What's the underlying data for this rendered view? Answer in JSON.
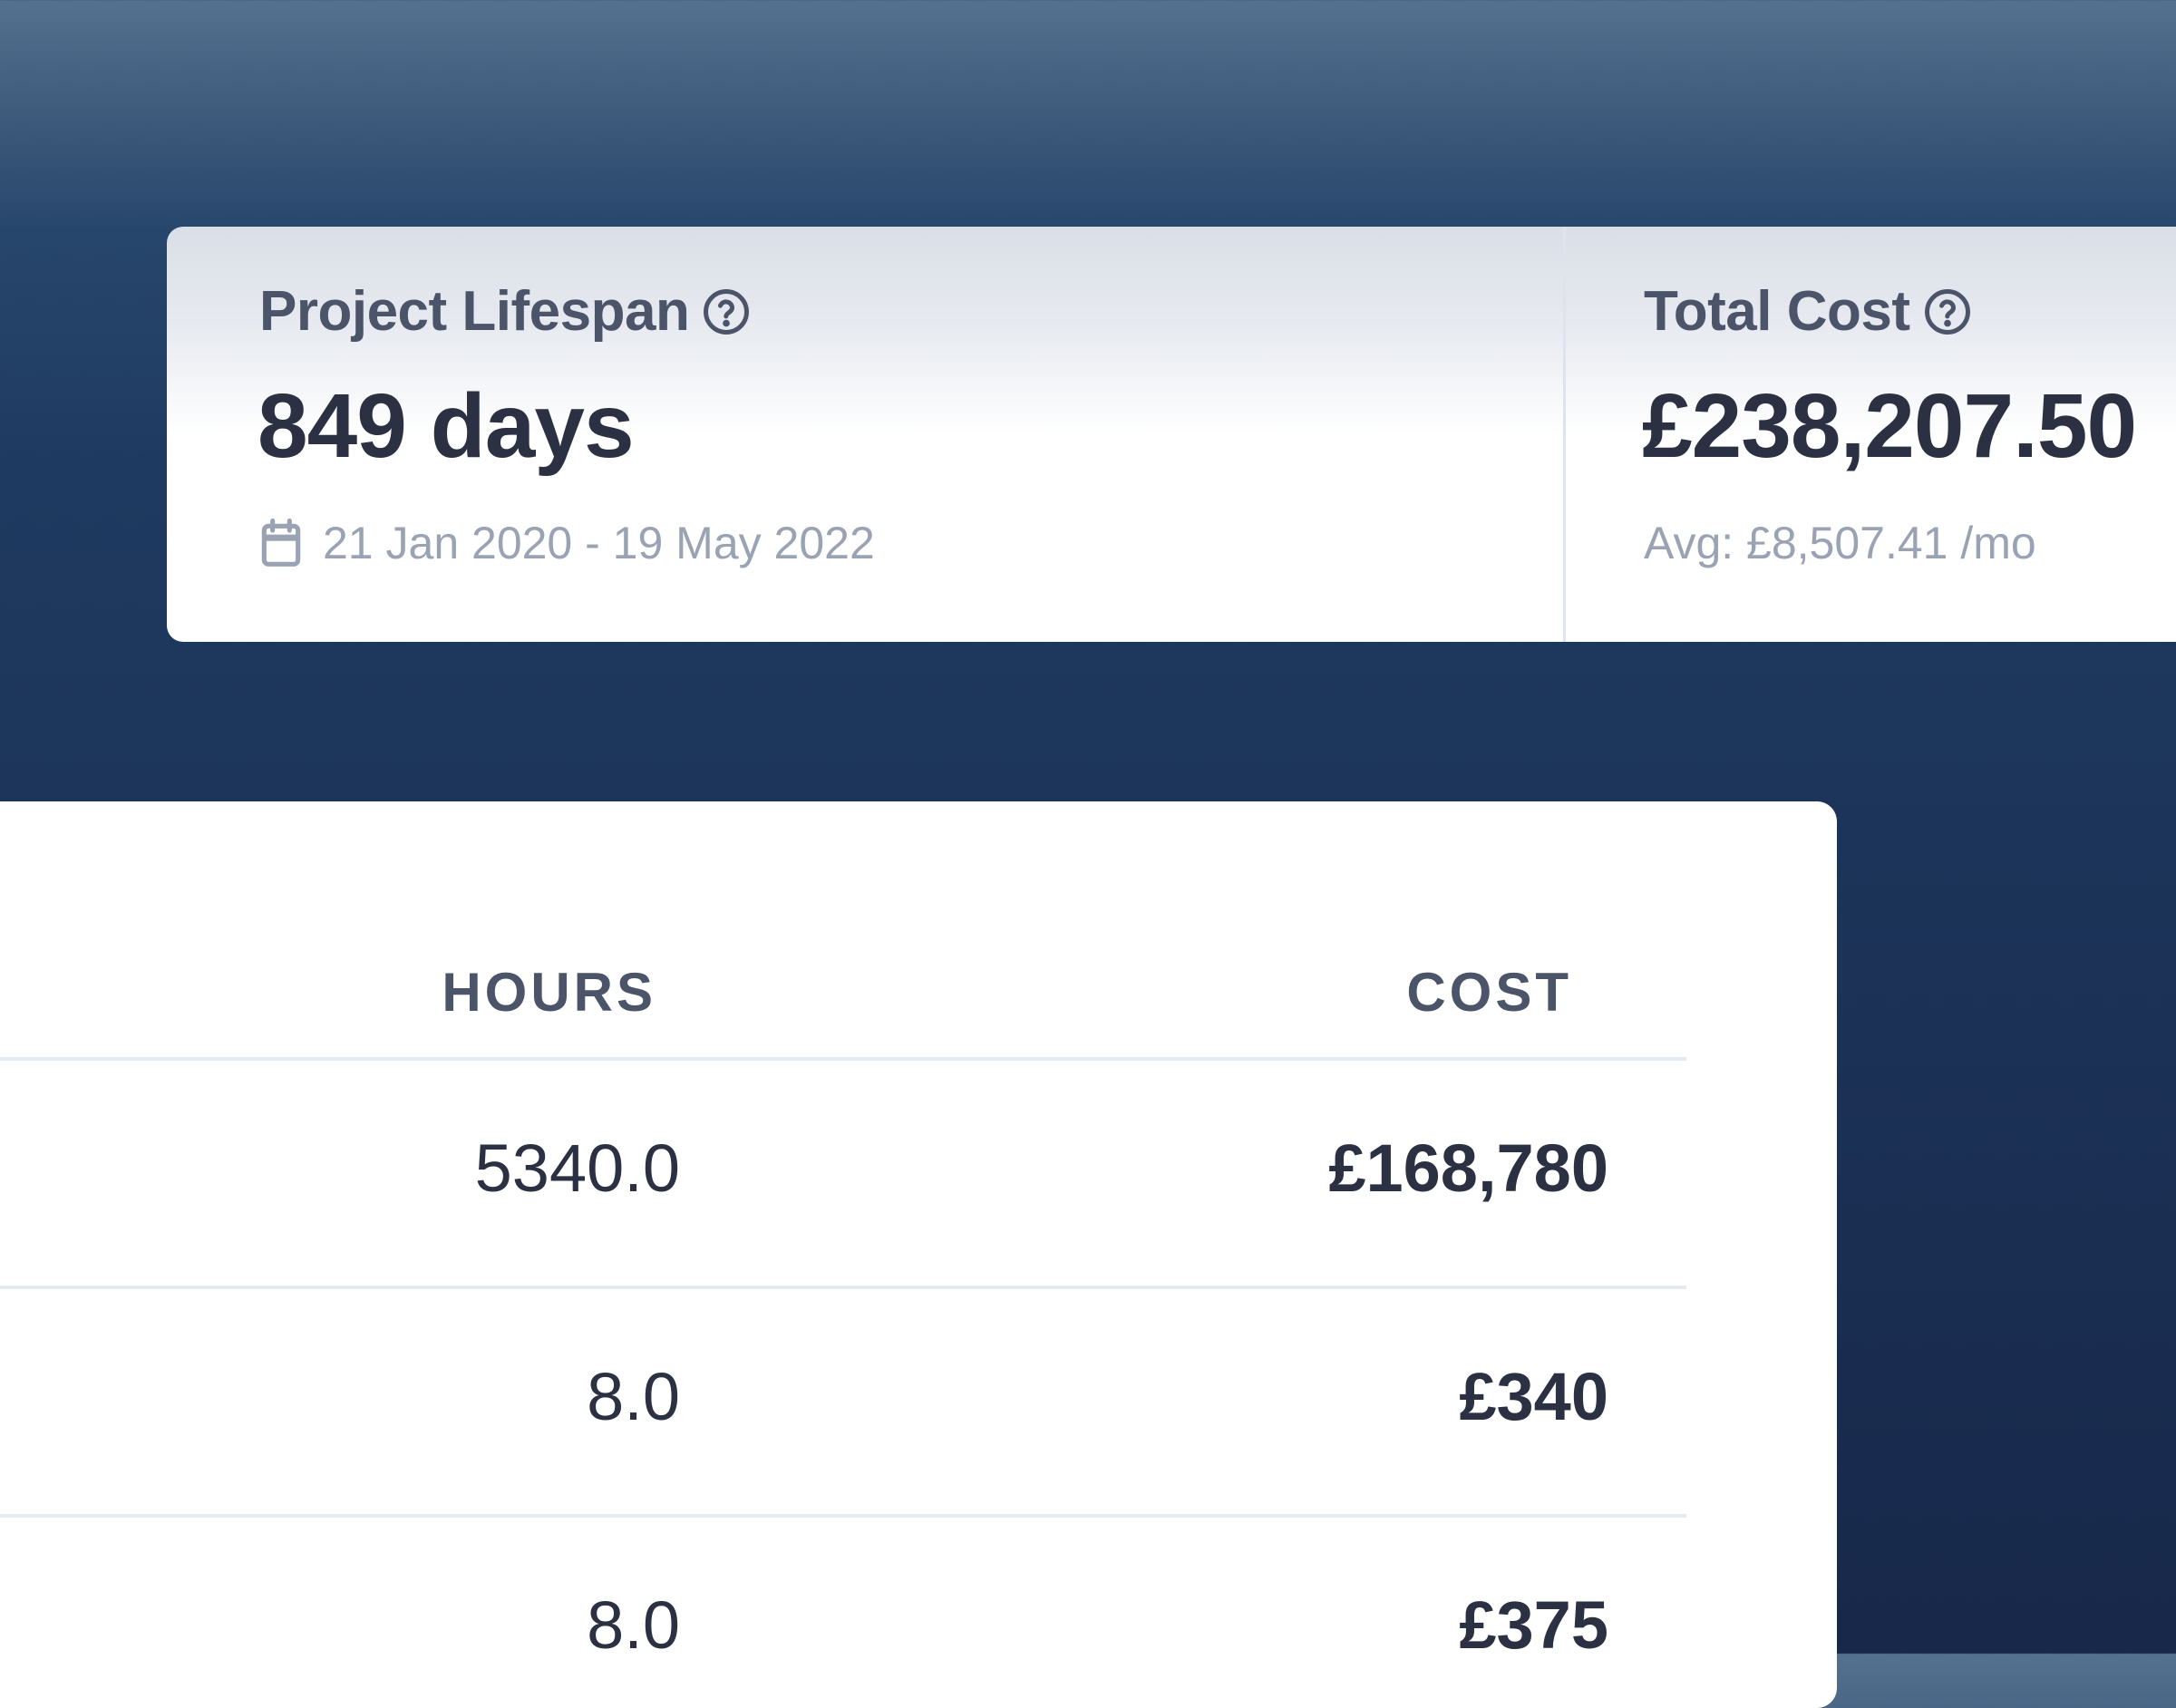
{
  "stats": {
    "lifespan": {
      "label": "Project Lifespan",
      "value": "849 days",
      "date_range": "21 Jan 2020 - 19 May 2022"
    },
    "total_cost": {
      "label": "Total Cost",
      "value": "£238,207.50",
      "average": "Avg: £8,507.41 /mo"
    }
  },
  "table": {
    "columns": {
      "hours": "HOURS",
      "cost": "COST"
    },
    "rows": [
      {
        "hours": "5340.0",
        "cost": "£168,780"
      },
      {
        "hours": "8.0",
        "cost": "£340"
      },
      {
        "hours": "8.0",
        "cost": "£375"
      }
    ]
  },
  "icons": {
    "help": "help-circle-icon",
    "calendar": "calendar-icon"
  },
  "colors": {
    "background_top": "#55718f",
    "background_bottom": "#17284a",
    "text_primary": "#2b3142",
    "text_label": "#4b5468",
    "text_muted": "#9aa3b4",
    "divider": "#e6eaf0"
  }
}
